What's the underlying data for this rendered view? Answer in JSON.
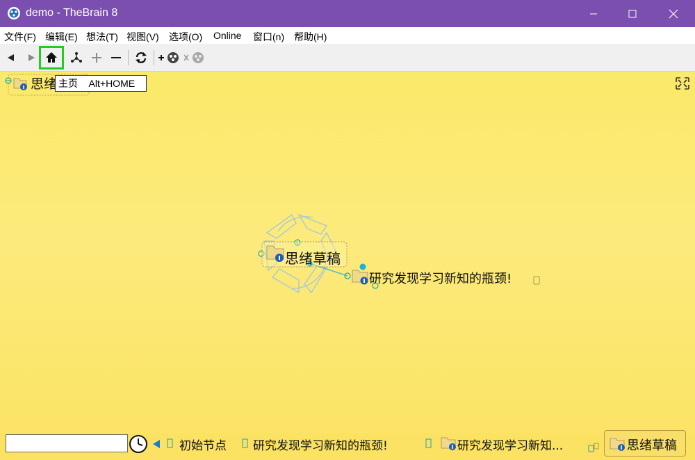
{
  "window": {
    "title": "demo - TheBrain 8"
  },
  "menu": [
    {
      "id": "file",
      "label": "文件(F)"
    },
    {
      "id": "edit",
      "label": "编辑(E)"
    },
    {
      "id": "thought",
      "label": "想法(T)"
    },
    {
      "id": "view",
      "label": "视图(V)"
    },
    {
      "id": "options",
      "label": "选项(O)"
    },
    {
      "id": "online",
      "label": "Online"
    },
    {
      "id": "window",
      "label": "窗口(n)"
    },
    {
      "id": "help",
      "label": "帮助(H)"
    }
  ],
  "toolbar": {
    "tooltip": "主页    Alt+HOME",
    "highlight_color": "#22cc22"
  },
  "brain": {
    "pinned_thought": "思绪",
    "central_thought": "思绪草稿",
    "child_thought": "研究发现学习新知的瓶颈!"
  },
  "bottom": {
    "search_value": "",
    "history": [
      "初始节点",
      "研究发现学习新知的瓶颈!",
      "研究发现学习新知..."
    ],
    "current_thought": "思绪草稿"
  },
  "colors": {
    "titlebar": "#7b4fb0",
    "canvas_top": "#fbe96a",
    "canvas_bottom": "#fbe466",
    "link": "#00b8d8"
  },
  "icons": {
    "back": "back-arrow-icon",
    "forward": "forward-arrow-icon",
    "home": "home-icon",
    "layout": "plex-layout-icon",
    "zoom_in": "plus-icon",
    "zoom_out": "minus-icon",
    "refresh": "refresh-icon",
    "add_brain": "add-brain-icon",
    "remove_brain": "remove-brain-icon",
    "fullscreen": "fullscreen-icon",
    "history": "clock-icon"
  }
}
